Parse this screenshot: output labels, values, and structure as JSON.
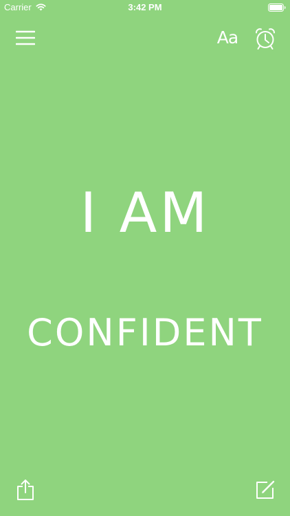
{
  "status_bar": {
    "carrier": "Carrier",
    "time": "3:42 PM",
    "wifi_icon": "wifi-icon",
    "battery_icon": "battery-icon"
  },
  "toolbar": {
    "menu_icon": "hamburger-menu-icon",
    "font_label": "Aa",
    "alarm_icon": "alarm-clock-icon"
  },
  "affirmation": {
    "line_1": "I AM",
    "line_2": "confident"
  },
  "bottom_toolbar": {
    "share_icon": "share-icon",
    "edit_icon": "edit-icon"
  },
  "colors": {
    "background": "#8fd47e",
    "foreground": "#ffffff"
  }
}
